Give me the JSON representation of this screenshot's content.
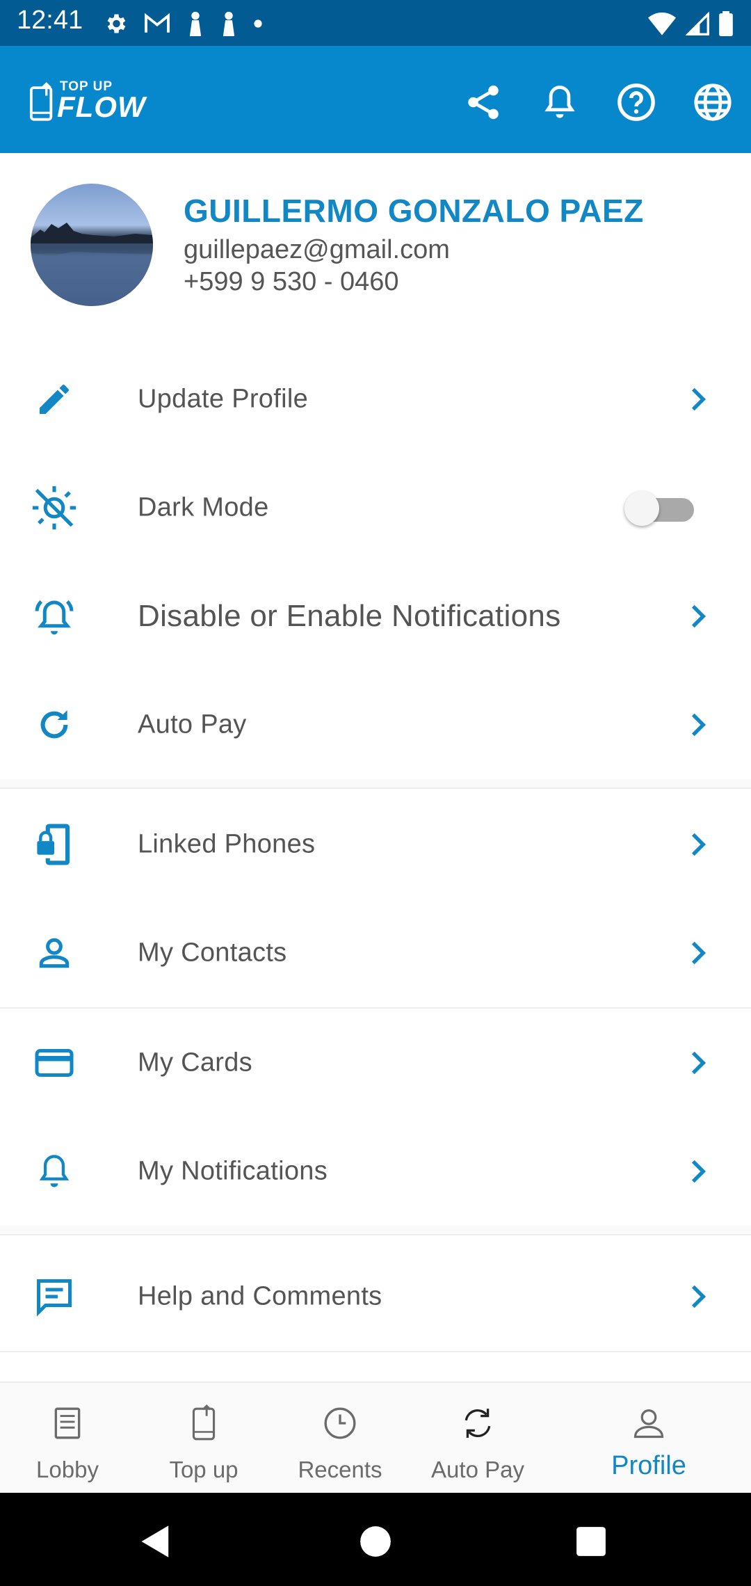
{
  "status_bar": {
    "time": "12:41",
    "left_icons": [
      "gear-icon",
      "gmail-icon",
      "notification-icon",
      "notification-icon",
      "dot-icon"
    ],
    "right_icons": [
      "wifi-icon",
      "signal-icon",
      "battery-icon"
    ]
  },
  "app_bar": {
    "logo_top": "TOP UP",
    "logo_main": "FLOW",
    "actions": [
      "share-icon",
      "bell-icon",
      "help-icon",
      "globe-icon"
    ],
    "color": "#0787cc"
  },
  "profile": {
    "name": "GUILLERMO GONZALO PAEZ",
    "email": "guillepaez@gmail.com",
    "phone": "+599 9 530 - 0460"
  },
  "menu": {
    "items": [
      {
        "label": "Update Profile",
        "icon": "pencil-icon"
      },
      {
        "label": "Dark Mode",
        "icon": "brightness-off-icon",
        "toggle": false
      },
      {
        "label": "Disable or Enable Notifications",
        "icon": "notification-ring-icon"
      },
      {
        "label": "Auto Pay",
        "icon": "refresh-icon"
      },
      {
        "label": "Linked Phones",
        "icon": "phone-lock-icon"
      },
      {
        "label": "My Contacts",
        "icon": "person-icon"
      },
      {
        "label": "My Cards",
        "icon": "credit-card-icon"
      },
      {
        "label": "My Notifications",
        "icon": "bell-icon"
      },
      {
        "label": "Help and Comments",
        "icon": "comment-icon"
      }
    ]
  },
  "bottom_nav": {
    "items": [
      {
        "label": "Lobby",
        "icon": "receipt-icon"
      },
      {
        "label": "Top up",
        "icon": "phone-upload-icon"
      },
      {
        "label": "Recents",
        "icon": "clock-icon"
      },
      {
        "label": "Auto Pay",
        "icon": "sync-icon"
      },
      {
        "label": "Profile",
        "icon": "person-outline-icon"
      }
    ],
    "active": "Profile"
  },
  "colors": {
    "accent": "#1287c6",
    "status_bar": "#025b92",
    "label": "#545454"
  }
}
